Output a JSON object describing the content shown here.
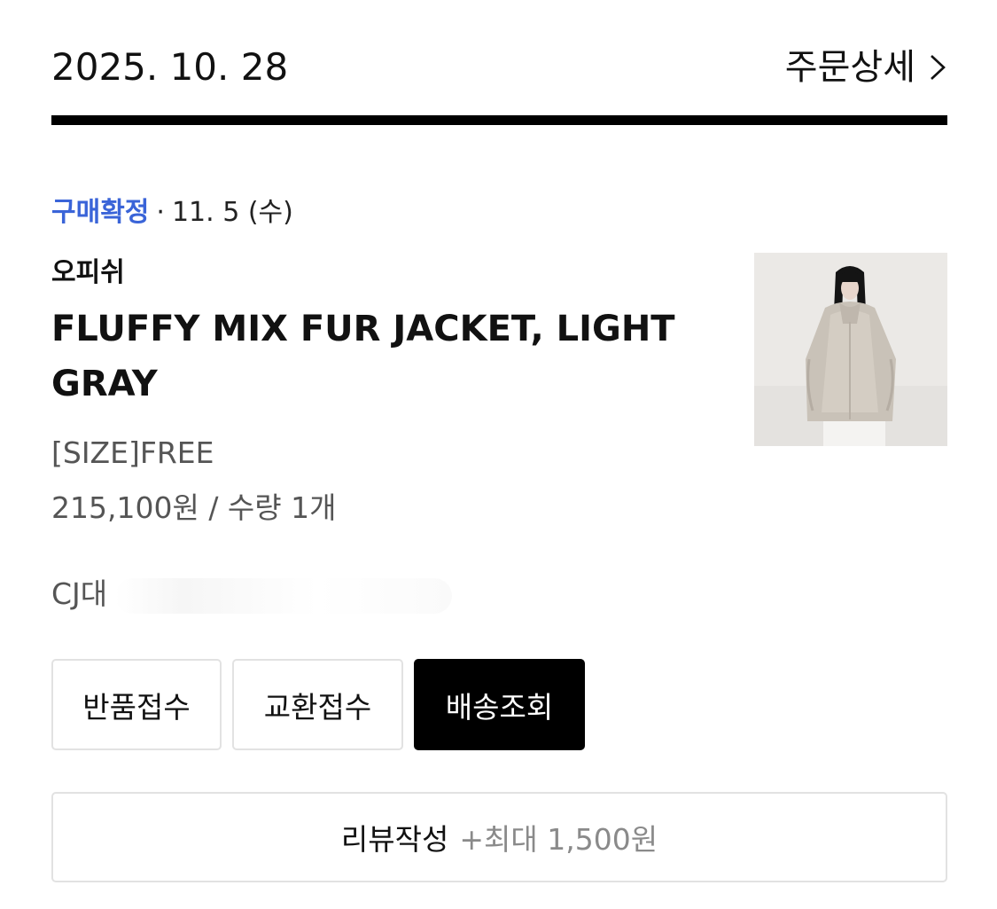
{
  "order": {
    "date": "2025. 10. 28",
    "detail_label": "주문상세",
    "detail_icon": "chevron-right-icon"
  },
  "item": {
    "status": "구매확정",
    "status_separator": "·",
    "status_date": "11. 5 (수)",
    "brand": "오피쉬",
    "name": "FLUFFY MIX FUR JACKET, LIGHT GRAY",
    "option": "[SIZE]FREE",
    "price_quantity": "215,100원 / 수량 1개",
    "courier": "CJ대"
  },
  "actions": {
    "return_label": "반품접수",
    "exchange_label": "교환접수",
    "tracking_label": "배송조회"
  },
  "review": {
    "label": "리뷰작성",
    "reward": "+최대 1,500원"
  },
  "colors": {
    "status_blue": "#3a64d8",
    "primary_button": "#000000",
    "border": "#e2e2e2",
    "secondary_text": "#555555"
  }
}
